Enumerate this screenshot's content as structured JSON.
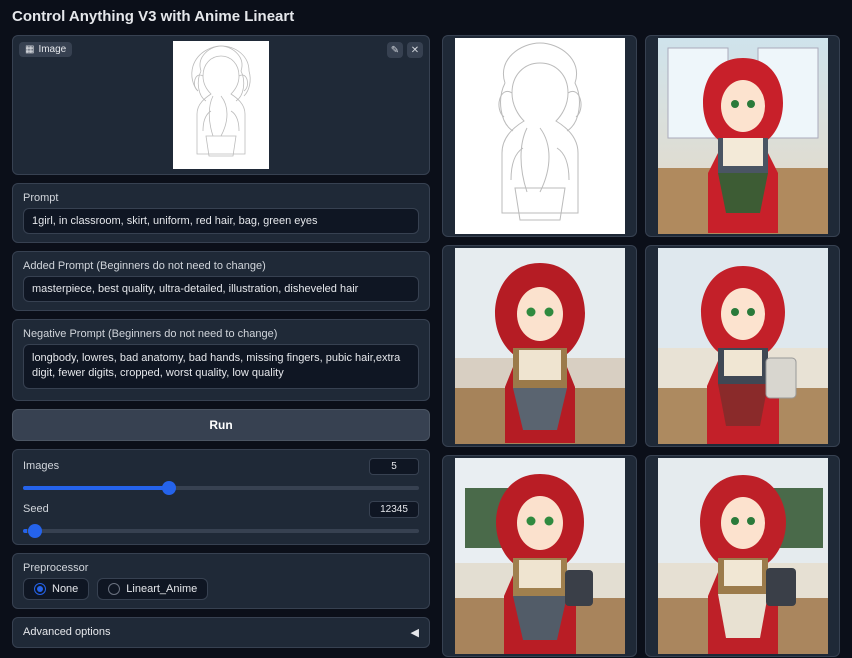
{
  "title": "Control Anything V3 with Anime Lineart",
  "image_badge": "Image",
  "prompt": {
    "label": "Prompt",
    "value": "1girl, in classroom, skirt, uniform, red hair, bag, green eyes"
  },
  "added_prompt": {
    "label": "Added Prompt (Beginners do not need to change)",
    "value": "masterpiece, best quality, ultra-detailed, illustration, disheveled hair"
  },
  "negative_prompt": {
    "label": "Negative Prompt (Beginners do not need to change)",
    "value": "longbody, lowres, bad anatomy, bad hands, missing fingers, pubic hair,extra digit, fewer digits, cropped, worst quality, low quality"
  },
  "run_label": "Run",
  "images_slider": {
    "label": "Images",
    "value": "5",
    "min": "1",
    "max": "12"
  },
  "seed_slider": {
    "label": "Seed",
    "value": "12345",
    "min": "0",
    "max": "999999"
  },
  "preprocessor": {
    "label": "Preprocessor",
    "options": {
      "none": "None",
      "lineart": "Lineart_Anime"
    },
    "selected": "none"
  },
  "advanced_label": "Advanced options"
}
